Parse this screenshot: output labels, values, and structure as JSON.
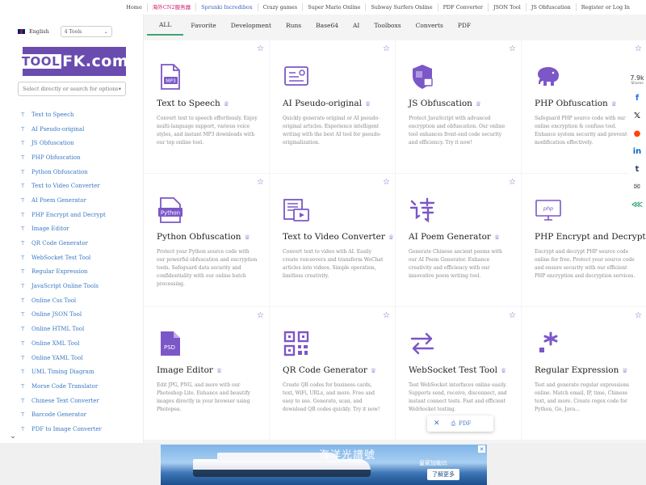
{
  "topnav": {
    "links": [
      {
        "label": "Home",
        "style": ""
      },
      {
        "label": "海外CN2服务器",
        "style": "hot"
      },
      {
        "label": "Sprunki Incredibox",
        "style": "blue"
      },
      {
        "label": "Crazy games",
        "style": ""
      },
      {
        "label": "Super Mario Online",
        "style": ""
      },
      {
        "label": "Subway Surfers Online",
        "style": ""
      },
      {
        "label": "PDF Converter",
        "style": ""
      },
      {
        "label": "JSON Tool",
        "style": ""
      },
      {
        "label": "JS Obfuscation",
        "style": ""
      },
      {
        "label": "Register or Log In",
        "style": ""
      }
    ]
  },
  "sidebar": {
    "language": "English",
    "tools_select": "4 Tools",
    "logo_prefix": "TOOL",
    "logo_suffix": "FK.com",
    "search_placeholder": "Select directly or search for options",
    "items": [
      "Text to Speech",
      "AI Pseudo-original",
      "JS Obfuscation",
      "PHP Obfuscation",
      "Python Obfuscation",
      "Text to Video Converter",
      "AI Poem Generator",
      "PHP Encrypt and Decrypt",
      "Image Editor",
      "QR Code Generator",
      "WebSocket Test Tool",
      "Regular Expression",
      "JavaScript Online Tools",
      "Online Css Tool",
      "Online JSON Tool",
      "Online HTML Tool",
      "Online XML Tool",
      "Online YAML Tool",
      "UML Timing Diagram",
      "Morse Code Translator",
      "Chinese Text Converter",
      "Barcode Generator",
      "PDF to Image Converter"
    ]
  },
  "categories": [
    "ALL",
    "Favorite",
    "Development",
    "Runs",
    "Base64",
    "AI",
    "Toolboxs",
    "Converts",
    "PDF"
  ],
  "cards": [
    {
      "title": "Text to Speech",
      "icon": "mp3-file-icon",
      "desc": "Convert text to speech effortlessly. Enjoy multi-language support, various voice styles, and instant MP3 downloads with our top online tool."
    },
    {
      "title": "AI Pseudo-original",
      "icon": "ai-document-icon",
      "desc": "Quickly generate original or AI pseudo-original articles. Experience intelligent writing with the best AI tool for pseudo-originalization."
    },
    {
      "title": "JS Obfuscation",
      "icon": "shield-lock-icon",
      "desc": "Protect JavaScript with advanced encryption and obfuscation. Our online tool enhances front-end code security and efficiency. Try it now!"
    },
    {
      "title": "PHP Obfuscation",
      "icon": "php-elephant-icon",
      "desc": "Safeguard PHP source code with our online encryption & confuse tool. Enhance system security and prevent modification effectively."
    },
    {
      "title": "Python Obfuscation",
      "icon": "python-file-icon",
      "desc": "Protect your Python source code with our powerful obfuscation and encryption tools. Safeguard data security and confidentiality with our online batch processing."
    },
    {
      "title": "Text to Video Converter",
      "icon": "text-video-icon",
      "desc": "Convert text to video with AI. Easily create voiceovers and transform WeChat articles into videos. Simple operation, limitless creativity."
    },
    {
      "title": "AI Poem Generator",
      "icon": "poem-character-icon",
      "desc": "Generate Chinese ancient poems with our AI Poem Generator. Enhance creativity and efficiency with our innovative poem writing tool."
    },
    {
      "title": "PHP Encrypt and Decrypt",
      "icon": "php-monitor-icon",
      "desc": "Encrypt and decrypt PHP source code online for free. Protect your source code and ensure security with our efficient PHP encryption and decryption services."
    },
    {
      "title": "Image Editor",
      "icon": "psd-file-icon",
      "desc": "Edit JPG, PNG, and more with our Photoshop Lite. Enhance and beautify images directly in your browser using Photopea."
    },
    {
      "title": "QR Code Generator",
      "icon": "qr-code-icon",
      "desc": "Create QR codes for business cards, text, WiFi, URLs, and more. Free and easy to use. Generate, scan, and download QR codes quickly. Try it now!"
    },
    {
      "title": "WebSocket Test Tool",
      "icon": "swap-arrows-icon",
      "desc": "Test WebSocket interfaces online easily. Supports send, receive, disconnect, and instant connect tests. Fast and efficient WebSocket testing."
    },
    {
      "title": "Regular Expression",
      "icon": "regex-asterisk-icon",
      "desc": "Test and generate regular expressions online. Match email, IP, time, Chinese text, and more. Create regex code for Python, Go, Java..."
    }
  ],
  "share": {
    "count": "7.9k",
    "label": "Shares",
    "buttons": [
      {
        "name": "facebook-icon",
        "glyph": "f",
        "color": "#1877f2"
      },
      {
        "name": "twitter-x-icon",
        "glyph": "𝕏",
        "color": "#111111"
      },
      {
        "name": "reddit-icon",
        "glyph": "●",
        "color": "#ff4500"
      },
      {
        "name": "linkedin-icon",
        "glyph": "in",
        "color": "#0a66c2"
      },
      {
        "name": "tumblr-icon",
        "glyph": "t",
        "color": "#35465c"
      },
      {
        "name": "email-icon",
        "glyph": "✉",
        "color": "#555555"
      },
      {
        "name": "share-more-icon",
        "glyph": "⋘",
        "color": "#3aa575"
      }
    ]
  },
  "float_pdf": {
    "label": "PDF"
  },
  "ad": {
    "headline": "海洋光譜號",
    "brand": "皇家加勒比",
    "cta": "了解更多"
  },
  "colors": {
    "accent": "#7b57c8",
    "link": "#3a78c4",
    "tab_active": "#3aa575"
  }
}
